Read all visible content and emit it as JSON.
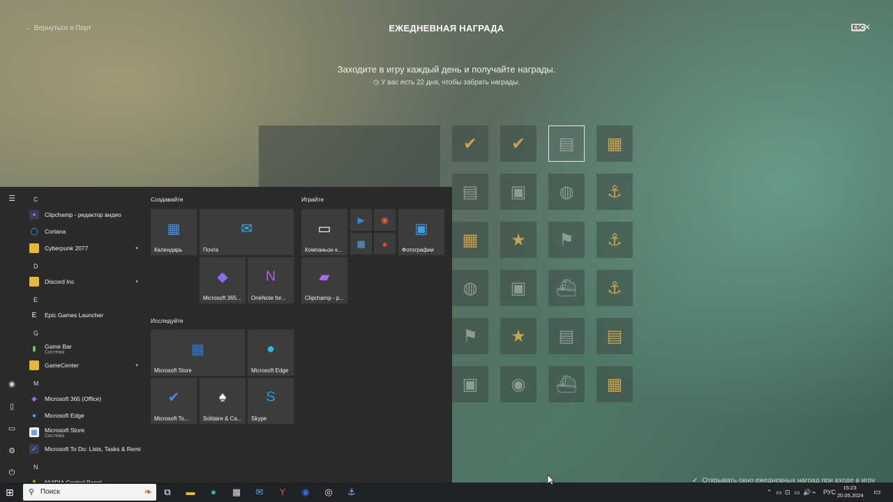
{
  "game": {
    "back_label": "← Вернуться в Порт",
    "title": "ЕЖЕДНЕВНАЯ НАГРАДА",
    "esc_label": "ESC",
    "close_symbol": "✕",
    "subtitle": "Заходите в игру каждый день и получайте награды.",
    "timer": "◷ У вас есть 22 дня, чтобы забрать награды.",
    "auto_open_checkbox": "✓",
    "auto_open_label": "Открывать окно ежедневных наград при входе в игру",
    "rewards": [
      {
        "icon": "check-icon",
        "glyph": "✔",
        "state": "claimed"
      },
      {
        "icon": "check-icon",
        "glyph": "✔",
        "state": "claimed"
      },
      {
        "icon": "credits-icon",
        "glyph": "▤",
        "state": "today"
      },
      {
        "icon": "crate-icon",
        "glyph": "▦",
        "state": "locked-gold"
      },
      {
        "icon": "credits-icon",
        "glyph": "▤",
        "state": "locked"
      },
      {
        "icon": "container-icon",
        "glyph": "▣",
        "state": "locked"
      },
      {
        "icon": "camouflage-icon",
        "glyph": "◍",
        "state": "locked"
      },
      {
        "icon": "anchor-icon",
        "glyph": "⚓",
        "state": "locked-gold"
      },
      {
        "icon": "crate-icon",
        "glyph": "▦",
        "state": "locked-gold"
      },
      {
        "icon": "star-icon",
        "glyph": "★",
        "state": "locked-gold"
      },
      {
        "icon": "flag-icon",
        "glyph": "⚑",
        "state": "locked"
      },
      {
        "icon": "anchor-icon",
        "glyph": "⚓",
        "state": "locked-gold"
      },
      {
        "icon": "camouflage-icon",
        "glyph": "◍",
        "state": "locked"
      },
      {
        "icon": "container-icon",
        "glyph": "▣",
        "state": "locked"
      },
      {
        "icon": "ship-icon",
        "glyph": "⛴",
        "state": "locked"
      },
      {
        "icon": "anchor-icon",
        "glyph": "⚓",
        "state": "locked-gold"
      },
      {
        "icon": "flag-icon",
        "glyph": "⚑",
        "state": "locked"
      },
      {
        "icon": "star-icon",
        "glyph": "★",
        "state": "locked-gold"
      },
      {
        "icon": "credits-icon",
        "glyph": "▤",
        "state": "locked"
      },
      {
        "icon": "gold-coins-icon",
        "glyph": "▤",
        "state": "locked-gold"
      },
      {
        "icon": "container-icon",
        "glyph": "▣",
        "state": "locked"
      },
      {
        "icon": "container-icon",
        "glyph": "◉",
        "state": "locked"
      },
      {
        "icon": "ship-icon",
        "glyph": "⛴",
        "state": "locked"
      },
      {
        "icon": "crate-icon",
        "glyph": "▦",
        "state": "locked-gold"
      }
    ]
  },
  "start_menu": {
    "rail_icons": [
      {
        "name": "hamburger-icon",
        "glyph": "☰"
      },
      {
        "name": "user-icon",
        "glyph": "◉"
      },
      {
        "name": "documents-icon",
        "glyph": "▯"
      },
      {
        "name": "pictures-icon",
        "glyph": "▭"
      },
      {
        "name": "settings-icon",
        "glyph": "⚙"
      },
      {
        "name": "power-icon",
        "glyph": "⏻"
      }
    ],
    "letters": [
      "C",
      "D",
      "E",
      "G",
      "M",
      "N"
    ],
    "apps": [
      {
        "label": "Clipchamp - редактор видео",
        "sub": "",
        "icon": "clipchamp-icon",
        "glyph": "▪",
        "color": "#3a3d5c",
        "fg": "#c8a0ff",
        "chev": ""
      },
      {
        "label": "Cortana",
        "sub": "",
        "icon": "cortana-icon",
        "glyph": "◯",
        "color": "transparent",
        "fg": "#3ab0ff",
        "chev": ""
      },
      {
        "label": "Cyberpunk 2077",
        "sub": "",
        "icon": "folder-icon",
        "glyph": "▬",
        "color": "#e8b83a",
        "fg": "#e8b83a",
        "chev": "▾"
      },
      {
        "label": "Discord Inc",
        "sub": "",
        "icon": "folder-icon",
        "glyph": "▬",
        "color": "#e8b83a",
        "fg": "#e8b83a",
        "chev": "▾"
      },
      {
        "label": "Epic Games Launcher",
        "sub": "",
        "icon": "epic-icon",
        "glyph": "E",
        "color": "#2a2a2a",
        "fg": "#ffffff",
        "chev": ""
      },
      {
        "label": "Game Bar",
        "sub": "Система",
        "icon": "gamebar-icon",
        "glyph": "▮",
        "color": "#2a2a2a",
        "fg": "#5fd35f",
        "chev": ""
      },
      {
        "label": "GameCenter",
        "sub": "",
        "icon": "folder-icon",
        "glyph": "▬",
        "color": "#e8b83a",
        "fg": "#e8b83a",
        "chev": "▾"
      },
      {
        "label": "Microsoft 365 (Office)",
        "sub": "",
        "icon": "m365-icon",
        "glyph": "◆",
        "color": "transparent",
        "fg": "#8a6cf0",
        "chev": ""
      },
      {
        "label": "Microsoft Edge",
        "sub": "",
        "icon": "edge-icon",
        "glyph": "●",
        "color": "transparent",
        "fg": "#2fb5d8",
        "chev": ""
      },
      {
        "label": "Microsoft Store",
        "sub": "Система",
        "icon": "store-icon",
        "glyph": "▦",
        "color": "#f2f2f2",
        "fg": "#2a7ad8",
        "chev": ""
      },
      {
        "label": "Microsoft To Do: Lists, Tasks & Remin...",
        "sub": "",
        "icon": "todo-icon",
        "glyph": "✓",
        "color": "#3a3d5c",
        "fg": "#6fa8ff",
        "chev": ""
      },
      {
        "label": "NVIDIA Control Panel",
        "sub": "",
        "icon": "nvidia-icon",
        "glyph": "▮",
        "color": "#2a2a2a",
        "fg": "#76b900",
        "chev": ""
      }
    ],
    "groups": {
      "create": "Создавайте",
      "play": "Играйте",
      "explore": "Исследуйте"
    },
    "tiles": [
      {
        "name": "tile-calendar",
        "label": "Календарь",
        "icon": "calendar-icon",
        "glyph": "▦",
        "fg": "#3c8fe8"
      },
      {
        "name": "tile-mail",
        "label": "Почта",
        "icon": "mail-icon",
        "glyph": "✉",
        "fg": "#3ab0f0"
      },
      {
        "name": "tile-m365",
        "label": "Microsoft 365...",
        "icon": "m365-icon",
        "glyph": "◆",
        "fg": "#8a6cf0"
      },
      {
        "name": "tile-onenote",
        "label": "OneNote for...",
        "icon": "onenote-icon",
        "glyph": "N",
        "fg": "#b65ae0"
      },
      {
        "name": "tile-xbox-companion",
        "label": "Компаньон к...",
        "icon": "xbox-console-icon",
        "glyph": "▭",
        "fg": "#ffffff"
      },
      {
        "name": "tile-movies",
        "label": "",
        "icon": "movies-icon",
        "glyph": "▶",
        "fg": "#2a8ae0"
      },
      {
        "name": "tile-groove",
        "label": "",
        "icon": "groove-icon",
        "glyph": "◉",
        "fg": "#e05a3a"
      },
      {
        "name": "tile-calculator",
        "label": "",
        "icon": "calculator-icon",
        "glyph": "▦",
        "fg": "#5aa0e8"
      },
      {
        "name": "tile-maps",
        "label": "",
        "icon": "maps-icon",
        "glyph": "●",
        "fg": "#e04a2a"
      },
      {
        "name": "tile-photos",
        "label": "Фотографии",
        "icon": "photos-icon",
        "glyph": "▣",
        "fg": "#3aa0f0"
      },
      {
        "name": "tile-clipchamp",
        "label": "Clipchamp - р...",
        "icon": "clipchamp-icon",
        "glyph": "▰",
        "fg": "#a86cf0"
      },
      {
        "name": "tile-store",
        "label": "Microsoft Store",
        "icon": "store-icon",
        "glyph": "▦",
        "fg": "#2a7ad8"
      },
      {
        "name": "tile-edge",
        "label": "Microsoft Edge",
        "icon": "edge-icon",
        "glyph": "●",
        "fg": "#2fb5d8"
      },
      {
        "name": "tile-todo",
        "label": "Microsoft To...",
        "icon": "todo-icon",
        "glyph": "✔",
        "fg": "#3c8fe8"
      },
      {
        "name": "tile-solitaire",
        "label": "Solitaire & Ca...",
        "icon": "solitaire-icon",
        "glyph": "♠",
        "fg": "#ffffff"
      },
      {
        "name": "tile-skype",
        "label": "Skype",
        "icon": "skype-icon",
        "glyph": "S",
        "fg": "#1ea0e8"
      }
    ]
  },
  "taskbar": {
    "start_glyph": "⊞",
    "search_placeholder": "Поиск",
    "search_glyph": "⚲",
    "search_art_glyph": "❧",
    "pinned": [
      {
        "name": "task-view-icon",
        "glyph": "⧉",
        "fg": "#ffffff"
      },
      {
        "name": "file-explorer-icon",
        "glyph": "▬",
        "fg": "#e8b83a"
      },
      {
        "name": "edge-icon",
        "glyph": "●",
        "fg": "#2fb5d8"
      },
      {
        "name": "store-icon",
        "glyph": "▦",
        "fg": "#e0e0e0"
      },
      {
        "name": "mail-icon",
        "glyph": "✉",
        "fg": "#3ab0f0"
      },
      {
        "name": "yandex-browser-icon",
        "glyph": "Y",
        "fg": "#ff4a3a"
      },
      {
        "name": "game-app-icon",
        "glyph": "◉",
        "fg": "#3a6cf0"
      },
      {
        "name": "steering-app-icon",
        "glyph": "◎",
        "fg": "#e8e8e8"
      },
      {
        "name": "warships-icon",
        "glyph": "⚓",
        "fg": "#9ab0ff"
      }
    ],
    "tray": [
      "⌃",
      "▭",
      "⊡",
      "▭",
      "🔊",
      "⌁"
    ],
    "lang": "РУС",
    "time": "15:23",
    "date": "20.05.2024",
    "notif_glyph": "▭"
  }
}
